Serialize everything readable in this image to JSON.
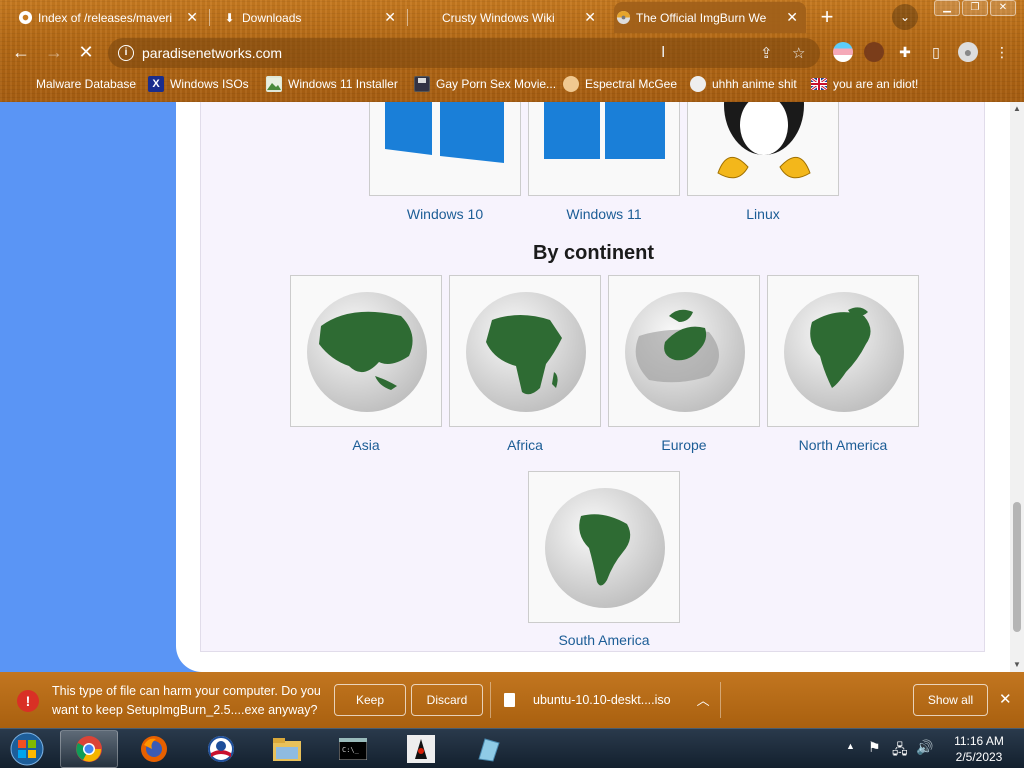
{
  "browser": {
    "tabs": [
      {
        "title": "Index of /releases/maveri",
        "favicon": "chrome-icon"
      },
      {
        "title": "Downloads",
        "favicon": "download-icon"
      },
      {
        "title": "Crusty Windows Wiki",
        "favicon": ""
      },
      {
        "title": "The Official ImgBurn We",
        "favicon": "imgburn-icon"
      }
    ],
    "url": "paradisenetworks.com",
    "bookmarks": [
      {
        "label": "Malware Database",
        "icon": "malware-icon"
      },
      {
        "label": "Windows ISOs",
        "icon": "x-icon"
      },
      {
        "label": "Windows 11 Installer",
        "icon": "image-icon"
      },
      {
        "label": "Gay Porn Sex Movie...",
        "icon": "floppy-icon"
      },
      {
        "label": "Espectral McGee",
        "icon": "face-icon"
      },
      {
        "label": "uhhh anime shit",
        "icon": "anime-icon"
      },
      {
        "label": "you are an idiot!",
        "icon": "flag-icon"
      }
    ]
  },
  "page": {
    "os_labels": {
      "win10": "Windows 10",
      "win11": "Windows 11",
      "linux": "Linux"
    },
    "continent_title": "By continent",
    "continents": {
      "asia": "Asia",
      "africa": "Africa",
      "europe": "Europe",
      "north_america": "North America",
      "south_america": "South America"
    }
  },
  "download_bar": {
    "message": "This type of file can harm your computer. Do you want to keep SetupImgBurn_2.5....exe anyway?",
    "keep": "Keep",
    "discard": "Discard",
    "file": "ubuntu-10.10-deskt....iso",
    "show_all": "Show all"
  },
  "taskbar": {
    "time": "11:16 AM",
    "date": "2/5/2023"
  },
  "colors": {
    "accent_link": "#1c5d96",
    "continent_green": "#2e6b33",
    "windows_blue": "#1a7fd8"
  }
}
